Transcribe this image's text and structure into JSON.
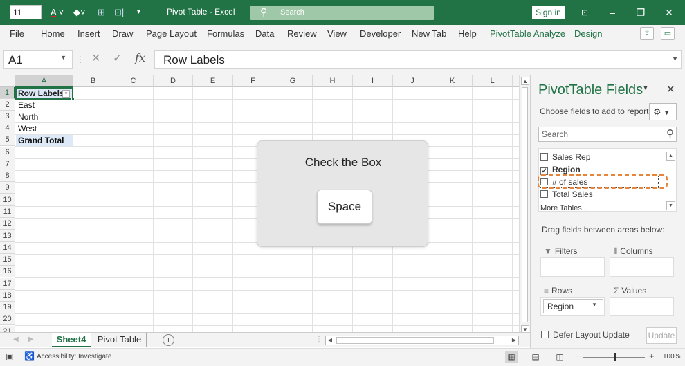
{
  "titlebar": {
    "font_size_value": "11",
    "title": "Pivot Table  -  Excel",
    "search_label": "Search",
    "sign_in": "Sign in"
  },
  "ribbon_tabs": [
    "File",
    "Home",
    "Insert",
    "Draw",
    "Page Layout",
    "Formulas",
    "Data",
    "Review",
    "View",
    "Developer",
    "New Tab",
    "Help",
    "PivotTable Analyze",
    "Design"
  ],
  "formula_bar": {
    "name_box": "A1",
    "formula": "Row Labels"
  },
  "columns": [
    "A",
    "B",
    "C",
    "D",
    "E",
    "F",
    "G",
    "H",
    "I",
    "J",
    "K",
    "L"
  ],
  "rows": [
    "1",
    "2",
    "3",
    "4",
    "5",
    "6",
    "7",
    "8",
    "9",
    "10",
    "11",
    "12",
    "13",
    "14",
    "15",
    "16",
    "17",
    "18",
    "19",
    "20",
    "21"
  ],
  "cells": {
    "a1": "Row Labels",
    "a2": "East",
    "a3": "North",
    "a4": "West",
    "a5": "Grand Total"
  },
  "popup": {
    "message": "Check the Box",
    "key": "Space"
  },
  "sheet_tabs": {
    "active": "Sheet4",
    "other": "Pivot Table"
  },
  "status": {
    "accessibility": "Accessibility: Investigate",
    "zoom": "100%"
  },
  "pivot_pane": {
    "title": "PivotTable Fields",
    "choose_label": "Choose fields to add to report:",
    "search_placeholder": "Search",
    "fields": [
      {
        "label": "Sales Rep",
        "checked": false
      },
      {
        "label": "Region",
        "checked": true
      },
      {
        "label": "# of sales",
        "checked": false
      },
      {
        "label": "Total Sales",
        "checked": false
      },
      {
        "label": "More Tables...",
        "checked": false
      }
    ],
    "drag_label": "Drag fields between areas below:",
    "areas": {
      "filters": "Filters",
      "columns": "Columns",
      "rows": "Rows",
      "values": "Values",
      "rows_item": "Region"
    },
    "defer_label": "Defer Layout Update",
    "update_button": "Update"
  },
  "colors": {
    "excel_green": "#217346",
    "highlight_orange": "#e5843a"
  }
}
